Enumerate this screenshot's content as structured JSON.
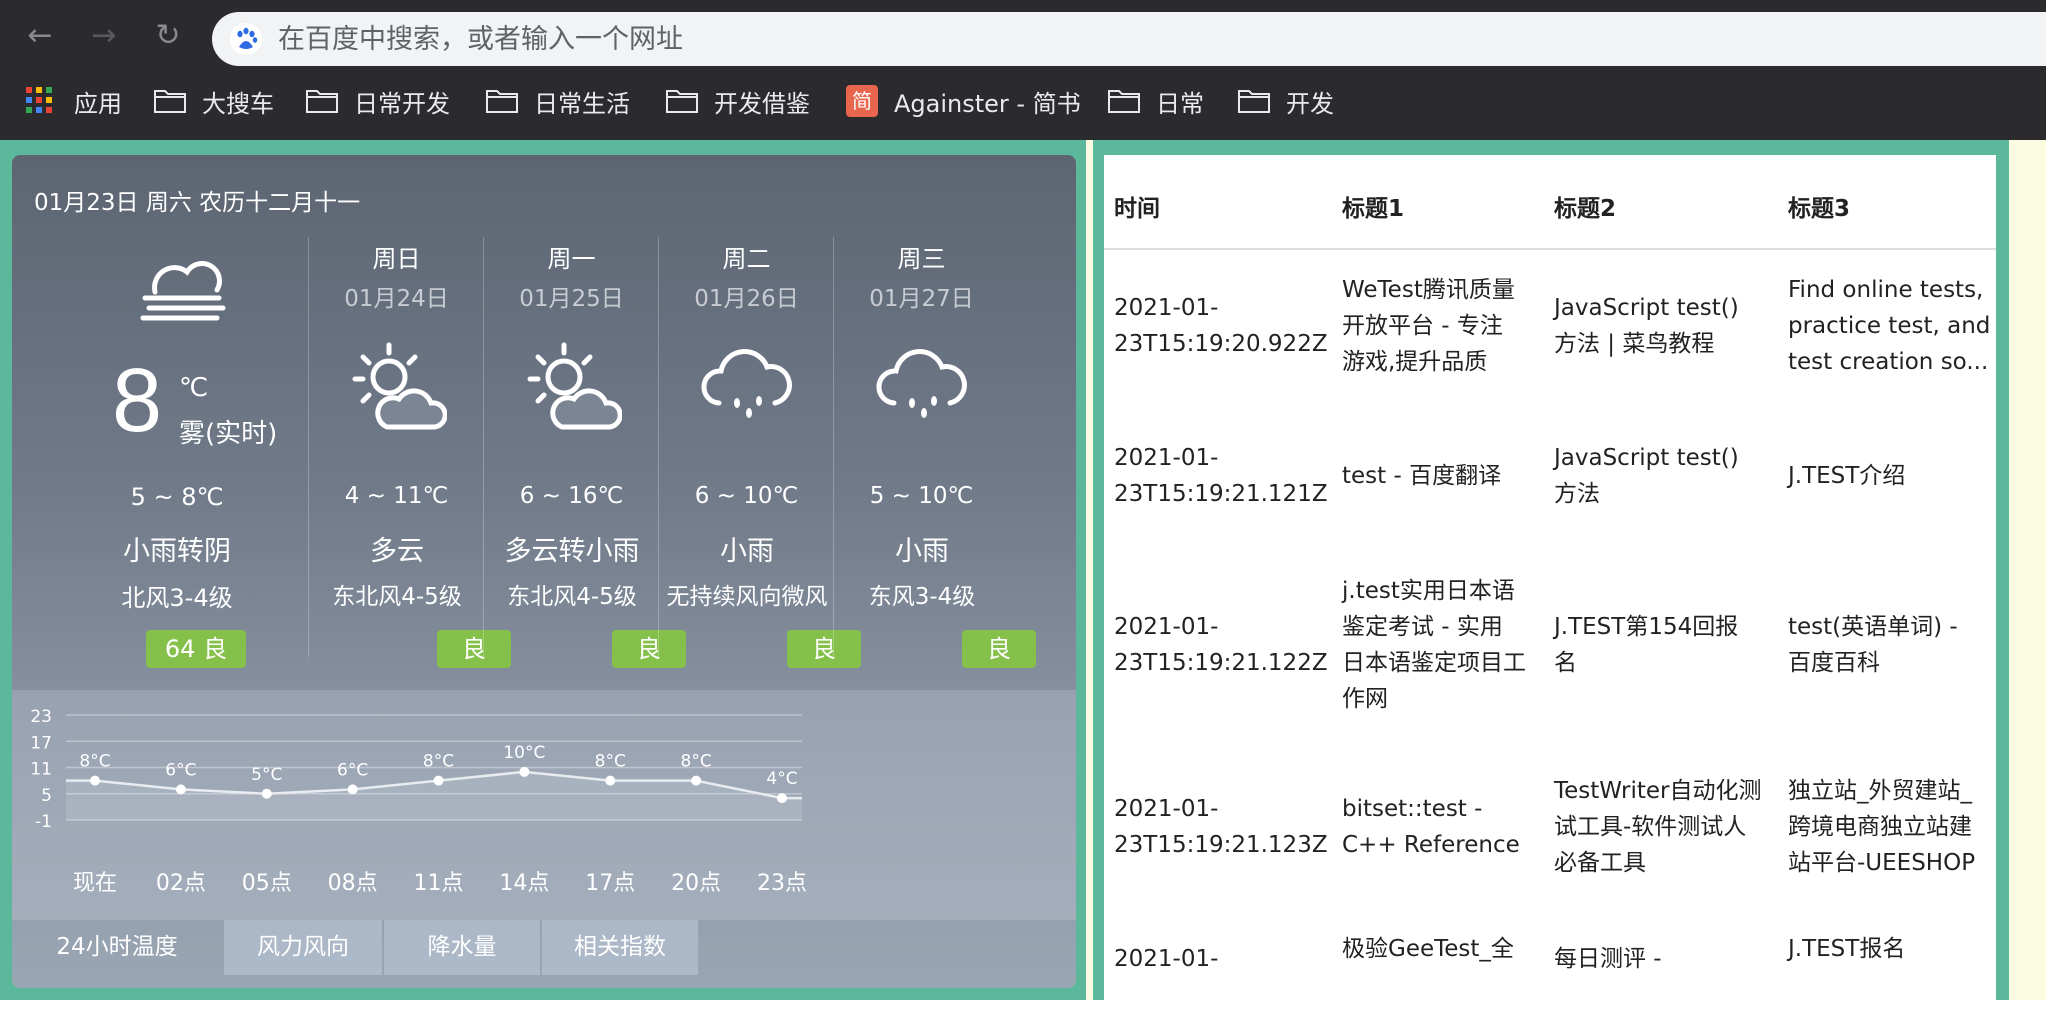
{
  "browser": {
    "address_placeholder": "在百度中搜索，或者输入一个网址",
    "bookmarks": [
      {
        "label": "应用",
        "icon": "apps-grid-icon"
      },
      {
        "label": "大搜车",
        "icon": "folder-icon"
      },
      {
        "label": "日常开发",
        "icon": "folder-icon"
      },
      {
        "label": "日常生活",
        "icon": "folder-icon"
      },
      {
        "label": "开发借鉴",
        "icon": "folder-icon"
      },
      {
        "label": "Againster - 简书",
        "icon": "jianshu-icon"
      },
      {
        "label": "日常",
        "icon": "folder-icon"
      },
      {
        "label": "开发",
        "icon": "folder-icon"
      }
    ]
  },
  "weather": {
    "date_line": "01月23日 周六 农历十二月十一",
    "today": {
      "temp": "8",
      "unit": "℃",
      "condition_now": "雾(实时)",
      "range": "5 ~ 8℃",
      "desc": "小雨转阴",
      "wind": "北风3-4级",
      "aqi": "64  良"
    },
    "days": [
      {
        "name": "周日",
        "date": "01月24日",
        "icon": "partly-cloudy-icon",
        "range": "4 ~ 11℃",
        "desc": "多云",
        "wind": "东北风4-5级",
        "aqi": "良"
      },
      {
        "name": "周一",
        "date": "01月25日",
        "icon": "partly-cloudy-icon",
        "range": "6 ~ 16℃",
        "desc": "多云转小雨",
        "wind": "东北风4-5级",
        "aqi": "良"
      },
      {
        "name": "周二",
        "date": "01月26日",
        "icon": "light-rain-icon",
        "range": "6 ~ 10℃",
        "desc": "小雨",
        "wind": "无持续风向微风",
        "aqi": "良"
      },
      {
        "name": "周三",
        "date": "01月27日",
        "icon": "light-rain-icon",
        "range": "5 ~ 10℃",
        "desc": "小雨",
        "wind": "东风3-4级",
        "aqi": "良"
      }
    ],
    "tabs": [
      "24小时温度",
      "风力风向",
      "降水量",
      "相关指数"
    ],
    "chart_data": {
      "type": "line",
      "categories": [
        "现在",
        "02点",
        "05点",
        "08点",
        "11点",
        "14点",
        "17点",
        "20点",
        "23点"
      ],
      "values": [
        8,
        6,
        5,
        6,
        8,
        10,
        8,
        8,
        4
      ],
      "data_labels": [
        "8°C",
        "6°C",
        "5°C",
        "6°C",
        "8°C",
        "10°C",
        "8°C",
        "8°C",
        "4°C"
      ],
      "yticks": [
        "23",
        "17",
        "11",
        "5",
        "-1"
      ],
      "ylim": [
        -1,
        23
      ],
      "grid": true
    }
  },
  "table": {
    "headers": [
      "时间",
      "标题1",
      "标题2",
      "标题3"
    ],
    "rows": [
      {
        "time": [
          "2021-01-",
          "23T15:19:20.922Z"
        ],
        "t1": [
          "WeTest腾讯质量",
          "开放平台 - 专注",
          "游戏,提升品质"
        ],
        "t2": [
          "JavaScript test()",
          "方法 | 菜鸟教程"
        ],
        "t3": [
          "Find online tests,",
          "practice test, and",
          "test creation so..."
        ]
      },
      {
        "time": [
          "2021-01-",
          "23T15:19:21.121Z"
        ],
        "t1": [
          "test - 百度翻译"
        ],
        "t2": [
          "JavaScript test()",
          "方法"
        ],
        "t3": [
          "J.TEST介绍"
        ]
      },
      {
        "time": [
          "2021-01-",
          "23T15:19:21.122Z"
        ],
        "t1": [
          "j.test实用日本语",
          "鉴定考试 - 实用",
          "日本语鉴定项目工",
          "作网"
        ],
        "t2": [
          "J.TEST第154回报",
          "名"
        ],
        "t3": [
          "test(英语单词) -",
          "百度百科"
        ]
      },
      {
        "time": [
          "2021-01-",
          "23T15:19:21.123Z"
        ],
        "t1": [
          "bitset::test -",
          "C++ Reference"
        ],
        "t2": [
          "TestWriter自动化测",
          "试工具-软件测试人",
          "必备工具"
        ],
        "t3": [
          "独立站_外贸建站_",
          "跨境电商独立站建",
          "站平台-UEESHOP"
        ]
      },
      {
        "time": [
          "2021-01-"
        ],
        "t1": [
          "极验GeeTest_全"
        ],
        "t2": [
          "每日测评 -"
        ],
        "t3": [
          "J.TEST报名"
        ]
      }
    ]
  }
}
